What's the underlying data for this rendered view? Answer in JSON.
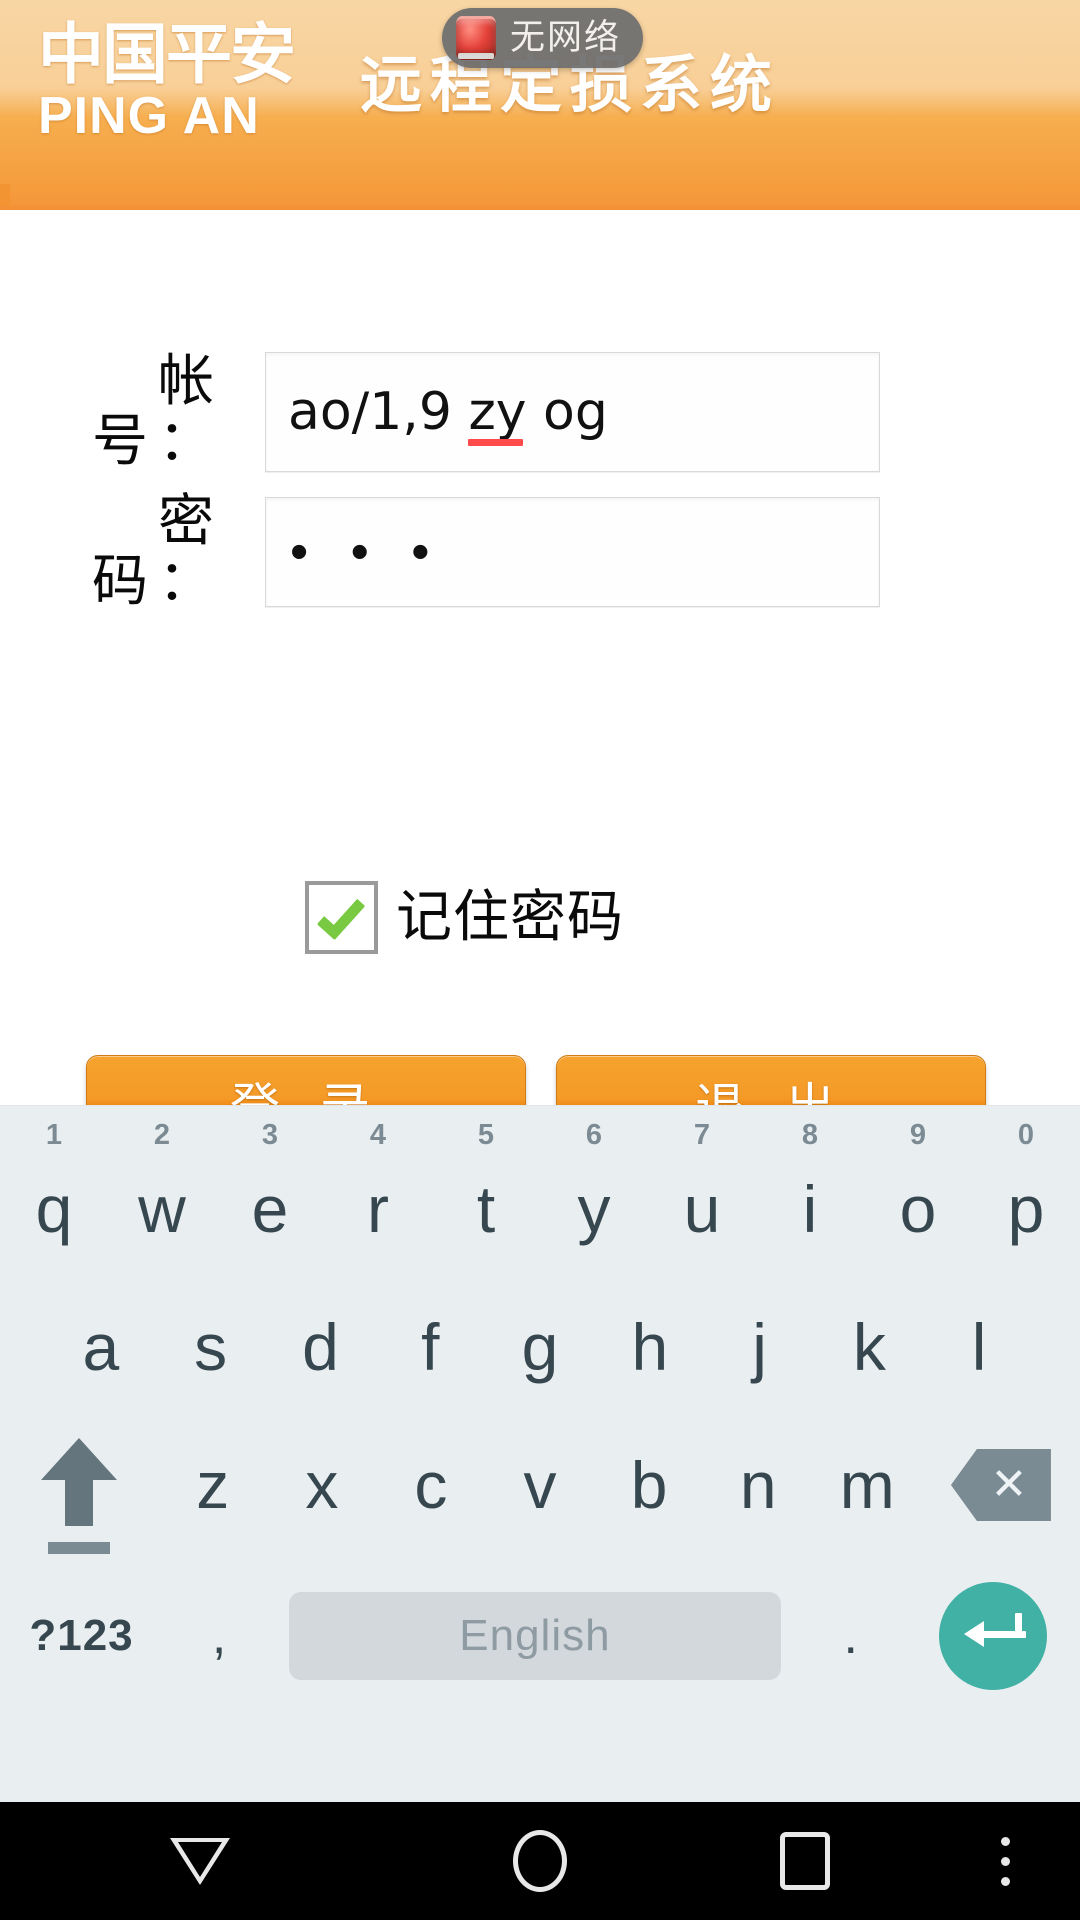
{
  "header": {
    "logo_cn": "中国平安",
    "logo_en": "PING AN",
    "app_title": "远程定损系统"
  },
  "toast": {
    "message": "无网络",
    "icon": "no-network-icon"
  },
  "form": {
    "account": {
      "label": "帐 号：",
      "value_prefix": "ao/1,9 ",
      "value_misspelled": "zy",
      "value_suffix": " og",
      "placeholder": ""
    },
    "password": {
      "label": "密 码：",
      "value": "• • •",
      "placeholder": ""
    },
    "remember": {
      "label": "记住密码",
      "checked": true
    },
    "buttons": {
      "login": "登 录",
      "exit": "退 出"
    }
  },
  "keyboard": {
    "row1": [
      {
        "key": "q",
        "num": "1"
      },
      {
        "key": "w",
        "num": "2"
      },
      {
        "key": "e",
        "num": "3"
      },
      {
        "key": "r",
        "num": "4"
      },
      {
        "key": "t",
        "num": "5"
      },
      {
        "key": "y",
        "num": "6"
      },
      {
        "key": "u",
        "num": "7"
      },
      {
        "key": "i",
        "num": "8"
      },
      {
        "key": "o",
        "num": "9"
      },
      {
        "key": "p",
        "num": "0"
      }
    ],
    "row2": [
      "a",
      "s",
      "d",
      "f",
      "g",
      "h",
      "j",
      "k",
      "l"
    ],
    "row3": [
      "z",
      "x",
      "c",
      "v",
      "b",
      "n",
      "m"
    ],
    "shift": "shift-icon",
    "backspace": "backspace-icon",
    "symbols_key": "?123",
    "comma_key": ",",
    "space_key": "English",
    "period_key": ".",
    "enter_key": "enter-icon"
  },
  "navbar": {
    "back": "back-triangle-icon",
    "home": "home-circle-icon",
    "recents": "recents-square-icon",
    "menu": "overflow-menu-icon"
  },
  "colors": {
    "header_top": "#f8d6a4",
    "header_bottom": "#f5943a",
    "button_orange": "#f09020",
    "check_green": "#7ac943",
    "keyboard_bg": "#e9eef1",
    "key_text": "#37474f",
    "enter_teal": "#41b0a5",
    "toast_bg": "#6e6e6e",
    "spell_underline": "#ff4b4b"
  }
}
